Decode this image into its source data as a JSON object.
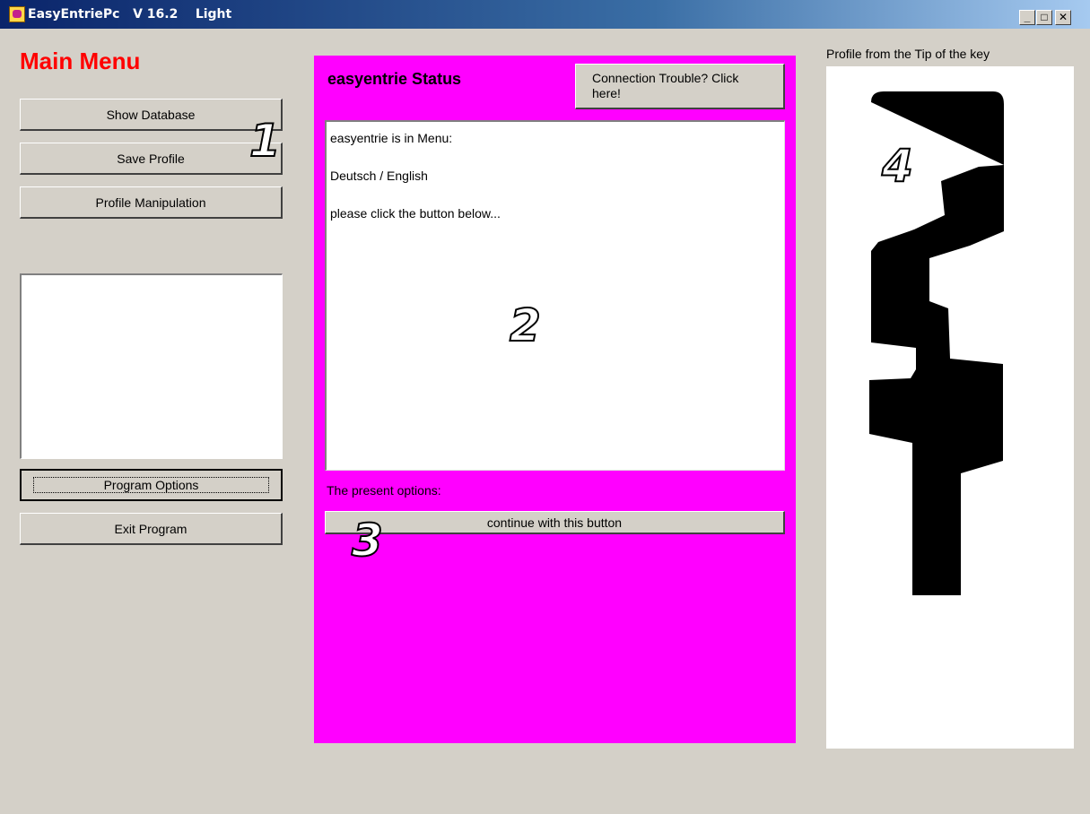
{
  "window": {
    "title": "EasyEntriePc   V 16.2    Light",
    "controls": {
      "minimize": "_",
      "maximize": "□",
      "close": "✕"
    }
  },
  "left_panel": {
    "title": "Main Menu",
    "buttons": {
      "show_database": "Show Database",
      "save_profile": "Save Profile",
      "profile_manipulation": "Profile Manipulation",
      "program_options": "Program Options",
      "exit_program": "Exit Program"
    }
  },
  "status_panel": {
    "title": "easyentrie Status",
    "connection_button": "Connection Trouble? Click here!",
    "messages": [
      "easyentrie is in Menu:",
      "Deutsch / English",
      "please click the button below..."
    ],
    "options_label": "The present options:",
    "continue_button": "continue with this button"
  },
  "profile_panel": {
    "label": "Profile from the Tip of the key"
  },
  "annotations": [
    "1",
    "2",
    "3",
    "4"
  ],
  "colors": {
    "title_bar_start": "#0a246a",
    "title_bar_end": "#a6caf0",
    "main_menu_title": "#ff0000",
    "status_panel_bg": "#ff00ff",
    "key_profile": "#000000"
  }
}
